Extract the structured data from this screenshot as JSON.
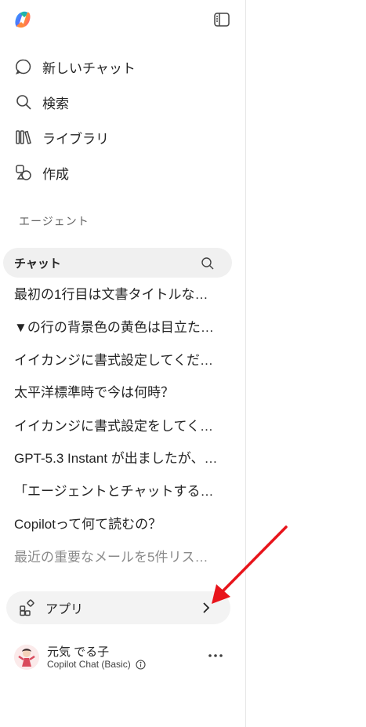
{
  "nav": {
    "new_chat": "新しいチャット",
    "search": "検索",
    "library": "ライブラリ",
    "create": "作成"
  },
  "agents_label": "エージェント",
  "chat_section": {
    "label": "チャット",
    "items": [
      "最初の1行目は文書タイトルな…",
      "▼の行の背景色の黄色は目立た…",
      "イイカンジに書式設定してくだ…",
      "太平洋標準時で今は何時？",
      "イイカンジに書式設定をしてく…",
      "GPT-5.3 Instant が出ましたが、…",
      "「エージェントとチャットする…",
      "Copilotって何て読むの？",
      "最近の重要なメールを5件リス…"
    ]
  },
  "apps": {
    "label": "アプリ"
  },
  "user": {
    "name": "元気 でる子",
    "plan": "Copilot Chat (Basic)"
  },
  "colors": {
    "annotation_arrow": "#e8141b",
    "chat_header_bg": "#f0f0f0",
    "apps_bg": "#f3f3f3"
  },
  "icons": [
    "copilot-logo",
    "sidebar-toggle-icon",
    "chat-bubble-icon",
    "search-icon",
    "library-icon",
    "create-icon",
    "apps-grid-icon",
    "chevron-right-icon",
    "info-icon",
    "more-icon"
  ]
}
